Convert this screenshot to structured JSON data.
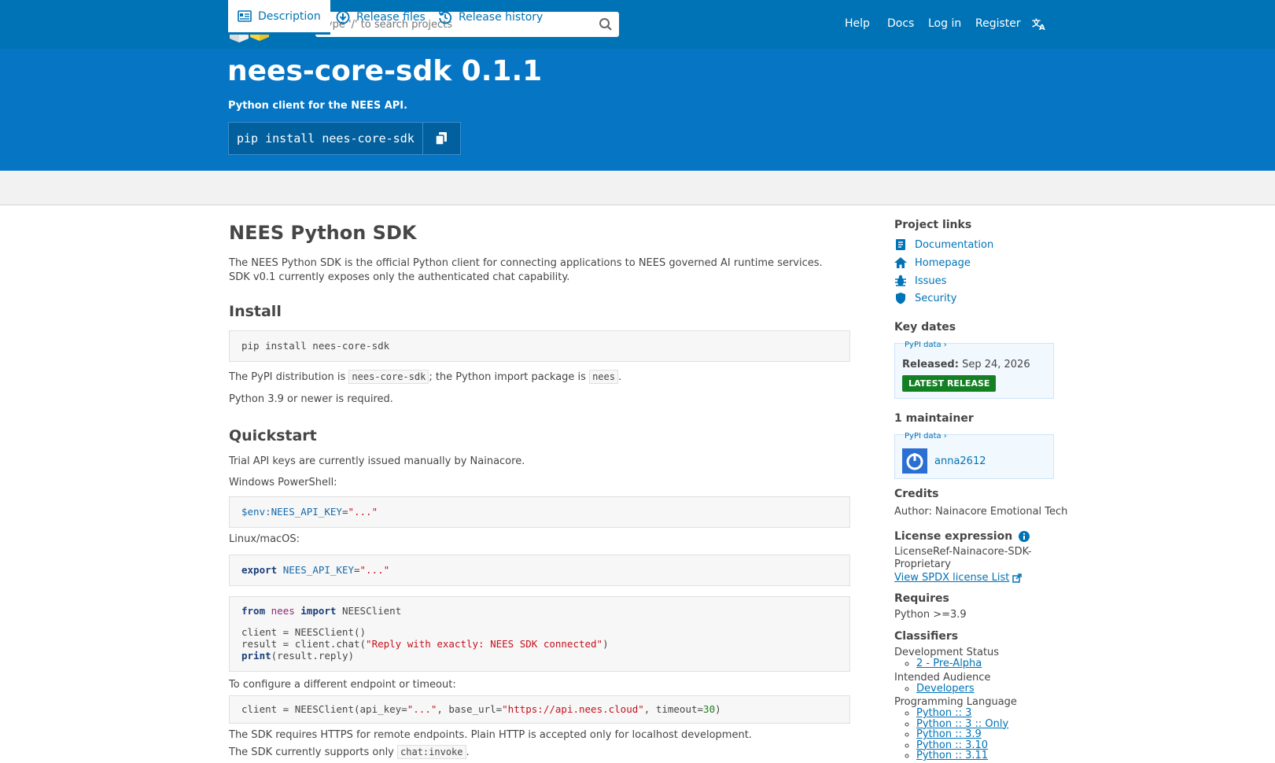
{
  "header": {
    "search_placeholder": "Type '/' to search projects",
    "nav": {
      "help": "Help",
      "docs": "Docs",
      "login": "Log in",
      "register": "Register"
    }
  },
  "package": {
    "title": "nees-core-sdk 0.1.1",
    "summary": "Python client for the NEES API.",
    "pip_command": "pip install nees-core-sdk"
  },
  "tabs": {
    "description": "Description",
    "release_files": "Release files",
    "release_history": "Release history"
  },
  "description": {
    "heading": "NEES Python SDK",
    "intro_line1": "The NEES Python SDK is the official Python client for connecting applications to NEES governed AI runtime services.",
    "intro_line2": "SDK v0.1 currently exposes only the authenticated chat capability.",
    "install_heading": "Install",
    "install_code": "pip install nees-core-sdk",
    "dist_text_a": "The PyPI distribution is ",
    "dist_code": "nees-core-sdk",
    "dist_text_b": "; the Python import package is ",
    "import_code": "nees",
    "dist_text_c": ".",
    "python_req": "Python 3.9 or newer is required.",
    "quickstart_heading": "Quickstart",
    "trial_text": "Trial API keys are currently issued manually by Nainacore.",
    "windows_label": "Windows PowerShell:",
    "linux_label": "Linux/macOS:",
    "config_text": "To configure a different endpoint or timeout:",
    "https_text": "The SDK requires HTTPS for remote endpoints. Plain HTTP is accepted only for localhost development.",
    "supports_text": "The SDK currently supports only ",
    "supports_code": "chat:invoke",
    "supports_end": "."
  },
  "sidebar": {
    "project_links_heading": "Project links",
    "links": {
      "documentation": "Documentation",
      "homepage": "Homepage",
      "issues": "Issues",
      "security": "Security"
    },
    "key_dates_heading": "Key dates",
    "pypi_data": "PyPI data ›",
    "released_label": "Released:",
    "released_date": "Sep 24, 2026",
    "latest_badge": "LATEST RELEASE",
    "maintainers_heading": "1 maintainer",
    "maintainer": "anna2612",
    "credits_heading": "Credits",
    "author": "Author: Nainacore Emotional Tech",
    "license_heading": "License expression",
    "license_line1": "LicenseRef-Nainacore-SDK-",
    "license_line2": "Proprietary",
    "spdx_link": "View SPDX license List",
    "requires_heading": "Requires",
    "requires_value": "Python >=3.9",
    "classifiers_heading": "Classifiers",
    "dev_status_label": "Development Status",
    "dev_status_value": "2 - Pre-Alpha",
    "audience_label": "Intended Audience",
    "audience_value": "Developers",
    "lang_label": "Programming Language",
    "lang_values": [
      "Python :: 3",
      "Python :: 3 :: Only",
      "Python :: 3.9",
      "Python :: 3.10",
      "Python :: 3.11"
    ]
  },
  "colors": {
    "brand_blue": "#0073b7",
    "hero_blue": "#0575c4",
    "badge_green": "#148024"
  }
}
